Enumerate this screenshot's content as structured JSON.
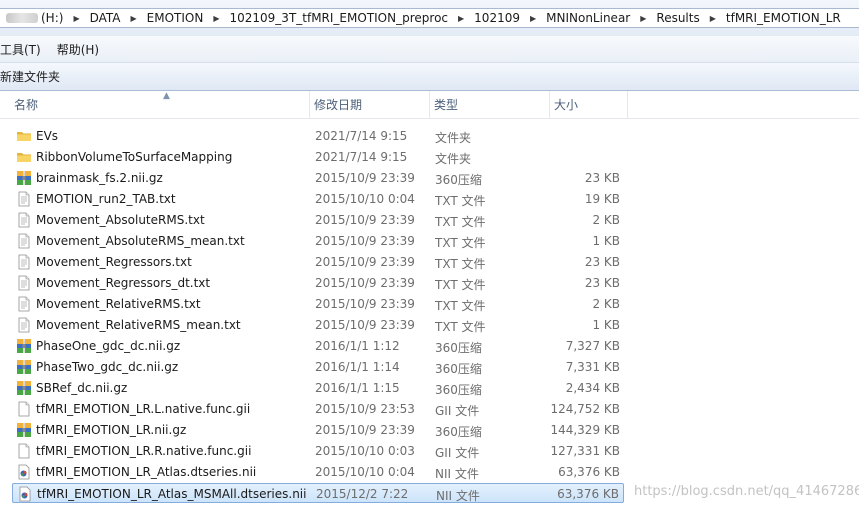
{
  "breadcrumb": {
    "items": [
      "(H:)",
      "DATA",
      "EMOTION",
      "102109_3T_tfMRI_EMOTION_preproc",
      "102109",
      "MNINonLinear",
      "Results",
      "tfMRI_EMOTION_LR"
    ]
  },
  "menu": {
    "tools": "工具(T)",
    "help": "帮助(H)"
  },
  "toolbar": {
    "new_folder": "新建文件夹"
  },
  "columns": {
    "name": "名称",
    "date": "修改日期",
    "type": "类型",
    "size": "大小"
  },
  "files": [
    {
      "name": "EVs",
      "date": "2021/7/14 9:15",
      "type": "文件夹",
      "size": "",
      "icon": "folder-icon"
    },
    {
      "name": "RibbonVolumeToSurfaceMapping",
      "date": "2021/7/14 9:15",
      "type": "文件夹",
      "size": "",
      "icon": "folder-icon"
    },
    {
      "name": "brainmask_fs.2.nii.gz",
      "date": "2015/10/9 23:39",
      "type": "360压缩",
      "size": "23 KB",
      "icon": "archive-icon"
    },
    {
      "name": "EMOTION_run2_TAB.txt",
      "date": "2015/10/10 0:04",
      "type": "TXT 文件",
      "size": "19 KB",
      "icon": "text-file-icon"
    },
    {
      "name": "Movement_AbsoluteRMS.txt",
      "date": "2015/10/9 23:39",
      "type": "TXT 文件",
      "size": "2 KB",
      "icon": "text-file-icon"
    },
    {
      "name": "Movement_AbsoluteRMS_mean.txt",
      "date": "2015/10/9 23:39",
      "type": "TXT 文件",
      "size": "1 KB",
      "icon": "text-file-icon"
    },
    {
      "name": "Movement_Regressors.txt",
      "date": "2015/10/9 23:39",
      "type": "TXT 文件",
      "size": "23 KB",
      "icon": "text-file-icon"
    },
    {
      "name": "Movement_Regressors_dt.txt",
      "date": "2015/10/9 23:39",
      "type": "TXT 文件",
      "size": "23 KB",
      "icon": "text-file-icon"
    },
    {
      "name": "Movement_RelativeRMS.txt",
      "date": "2015/10/9 23:39",
      "type": "TXT 文件",
      "size": "2 KB",
      "icon": "text-file-icon"
    },
    {
      "name": "Movement_RelativeRMS_mean.txt",
      "date": "2015/10/9 23:39",
      "type": "TXT 文件",
      "size": "1 KB",
      "icon": "text-file-icon"
    },
    {
      "name": "PhaseOne_gdc_dc.nii.gz",
      "date": "2016/1/1 1:12",
      "type": "360压缩",
      "size": "7,327 KB",
      "icon": "archive-icon"
    },
    {
      "name": "PhaseTwo_gdc_dc.nii.gz",
      "date": "2016/1/1 1:14",
      "type": "360压缩",
      "size": "7,331 KB",
      "icon": "archive-icon"
    },
    {
      "name": "SBRef_dc.nii.gz",
      "date": "2016/1/1 1:15",
      "type": "360压缩",
      "size": "2,434 KB",
      "icon": "archive-icon"
    },
    {
      "name": "tfMRI_EMOTION_LR.L.native.func.gii",
      "date": "2015/10/9 23:53",
      "type": "GII 文件",
      "size": "124,752 KB",
      "icon": "blank-file-icon"
    },
    {
      "name": "tfMRI_EMOTION_LR.nii.gz",
      "date": "2015/10/9 23:39",
      "type": "360压缩",
      "size": "144,329 KB",
      "icon": "archive-icon"
    },
    {
      "name": "tfMRI_EMOTION_LR.R.native.func.gii",
      "date": "2015/10/10 0:03",
      "type": "GII 文件",
      "size": "127,331 KB",
      "icon": "blank-file-icon"
    },
    {
      "name": "tfMRI_EMOTION_LR_Atlas.dtseries.nii",
      "date": "2015/10/10 0:04",
      "type": "NII 文件",
      "size": "63,376 KB",
      "icon": "nii-file-icon"
    },
    {
      "name": "tfMRI_EMOTION_LR_Atlas_MSMAll.dtseries.nii",
      "date": "2015/12/2 7:22",
      "type": "NII 文件",
      "size": "63,376 KB",
      "icon": "nii-file-icon",
      "selected": true
    }
  ],
  "watermark": "https://blog.csdn.net/qq_41467286"
}
